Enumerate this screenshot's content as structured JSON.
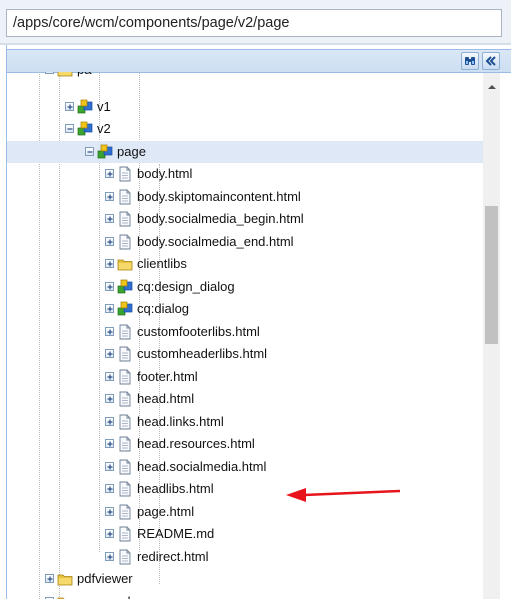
{
  "path_input": {
    "value": "/apps/core/wcm/components/page/v2/page"
  },
  "panel": {
    "buttons": [
      {
        "name": "find-icon"
      },
      {
        "name": "collapse-panel-icon"
      }
    ]
  },
  "tree": {
    "rows": [
      {
        "label": "pa",
        "depth": 2,
        "icon": "folder-icon",
        "expander": "minus",
        "partial": true
      },
      {
        "label": "v1",
        "depth": 3,
        "icon": "component-icon",
        "expander": "plus"
      },
      {
        "label": "v2",
        "depth": 3,
        "icon": "component-icon",
        "expander": "minus"
      },
      {
        "label": "page",
        "depth": 4,
        "icon": "component-icon",
        "expander": "minus",
        "selected": true
      },
      {
        "label": "body.html",
        "depth": 5,
        "icon": "file-icon",
        "expander": "plus"
      },
      {
        "label": "body.skiptomaincontent.html",
        "depth": 5,
        "icon": "file-icon",
        "expander": "plus"
      },
      {
        "label": "body.socialmedia_begin.html",
        "depth": 5,
        "icon": "file-icon",
        "expander": "plus"
      },
      {
        "label": "body.socialmedia_end.html",
        "depth": 5,
        "icon": "file-icon",
        "expander": "plus"
      },
      {
        "label": "clientlibs",
        "depth": 5,
        "icon": "folder-icon",
        "expander": "plus"
      },
      {
        "label": "cq:design_dialog",
        "depth": 5,
        "icon": "component-icon",
        "expander": "plus"
      },
      {
        "label": "cq:dialog",
        "depth": 5,
        "icon": "component-icon",
        "expander": "plus"
      },
      {
        "label": "customfooterlibs.html",
        "depth": 5,
        "icon": "file-icon",
        "expander": "plus"
      },
      {
        "label": "customheaderlibs.html",
        "depth": 5,
        "icon": "file-icon",
        "expander": "plus"
      },
      {
        "label": "footer.html",
        "depth": 5,
        "icon": "file-icon",
        "expander": "plus"
      },
      {
        "label": "head.html",
        "depth": 5,
        "icon": "file-icon",
        "expander": "plus"
      },
      {
        "label": "head.links.html",
        "depth": 5,
        "icon": "file-icon",
        "expander": "plus"
      },
      {
        "label": "head.resources.html",
        "depth": 5,
        "icon": "file-icon",
        "expander": "plus"
      },
      {
        "label": "head.socialmedia.html",
        "depth": 5,
        "icon": "file-icon",
        "expander": "plus"
      },
      {
        "label": "headlibs.html",
        "depth": 5,
        "icon": "file-icon",
        "expander": "plus"
      },
      {
        "label": "page.html",
        "depth": 5,
        "icon": "file-icon",
        "expander": "plus",
        "annotated": true
      },
      {
        "label": "README.md",
        "depth": 5,
        "icon": "file-icon",
        "expander": "plus"
      },
      {
        "label": "redirect.html",
        "depth": 5,
        "icon": "file-icon",
        "expander": "plus"
      },
      {
        "label": "pdfviewer",
        "depth": 2,
        "icon": "folder-icon",
        "expander": "plus"
      },
      {
        "label": "progressbar",
        "depth": 2,
        "icon": "folder-icon",
        "expander": "plus"
      }
    ]
  },
  "annotation": {
    "color": "#e8141b"
  },
  "colors": {
    "selected_row": "#dfe8f6",
    "folder": "#e8c23c",
    "component_blue": "#2f6fd0",
    "component_green": "#3aa52e"
  }
}
